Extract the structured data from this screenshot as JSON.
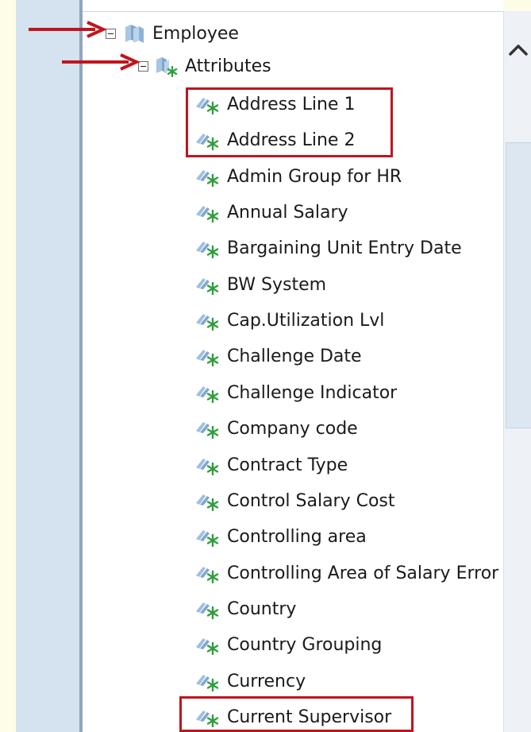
{
  "tree": {
    "root": {
      "label": "Employee",
      "icon": "dimension-icon",
      "state": "expanded"
    },
    "folder": {
      "label": "Attributes",
      "icon": "attribute-folder-icon",
      "state": "expanded"
    },
    "attributes": [
      "Address Line 1",
      "Address Line 2",
      "Admin Group for HR",
      "Annual Salary",
      "Bargaining Unit Entry Date",
      "BW System",
      "Cap.Utilization Lvl",
      "Challenge Date",
      "Challenge Indicator",
      "Company code",
      "Contract Type",
      "Control Salary Cost",
      "Controlling area",
      "Controlling Area of Salary Error",
      "Country",
      "Country Grouping",
      "Currency",
      "Current Supervisor"
    ],
    "highlighted": [
      "Address Line 1",
      "Address Line 2",
      "Current Supervisor"
    ]
  },
  "colors": {
    "highlight": "#c0151d",
    "annotation_arrow": "#c0151d",
    "attribute_star": "#2e9e3c",
    "icon_blue": "#8fb3d6"
  },
  "icons": {
    "attribute": "attribute-star-icon",
    "scroll_up": "chevron-up-icon",
    "collapse": "collapse-toggle-icon"
  }
}
